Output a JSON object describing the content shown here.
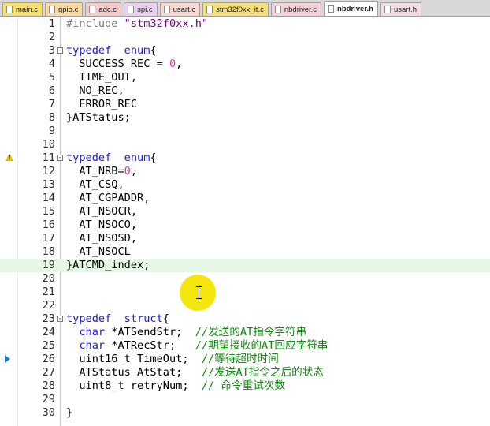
{
  "tabs": [
    {
      "label": "main.c",
      "color": "#f7e16b",
      "active": false
    },
    {
      "label": "gpio.c",
      "color": "#f9d9a0",
      "active": false
    },
    {
      "label": "adc.c",
      "color": "#f6c9c9",
      "active": false
    },
    {
      "label": "spi.c",
      "color": "#e9d0f0",
      "active": false
    },
    {
      "label": "usart.c",
      "color": "#f8d8d0",
      "active": false
    },
    {
      "label": "stm32f0xx_it.c",
      "color": "#f7e07a",
      "active": false
    },
    {
      "label": "nbdriver.c",
      "color": "#f6cfd9",
      "active": false
    },
    {
      "label": "nbdriver.h",
      "color": "#ffffff",
      "active": true
    },
    {
      "label": "usart.h",
      "color": "#f3dce6",
      "active": false
    }
  ],
  "editor": {
    "highlighted_line": 19,
    "lines": [
      {
        "n": "1",
        "segs": [
          [
            "pp",
            "#include "
          ],
          [
            "str",
            "\"stm32f0xx.h\""
          ]
        ]
      },
      {
        "n": "2",
        "segs": []
      },
      {
        "n": "3",
        "fold": "-",
        "segs": [
          [
            "kw",
            "typedef"
          ],
          [
            "",
            "  "
          ],
          [
            "kw",
            "enum"
          ],
          [
            "",
            "{"
          ]
        ]
      },
      {
        "n": "4",
        "segs": [
          [
            "",
            "  SUCCESS_REC = "
          ],
          [
            "num",
            "0"
          ],
          [
            "",
            ","
          ]
        ]
      },
      {
        "n": "5",
        "segs": [
          [
            "",
            "  TIME_OUT,"
          ]
        ]
      },
      {
        "n": "6",
        "segs": [
          [
            "",
            "  NO_REC,"
          ]
        ]
      },
      {
        "n": "7",
        "segs": [
          [
            "",
            "  ERROR_REC"
          ]
        ]
      },
      {
        "n": "8",
        "segs": [
          [
            "",
            "}ATStatus;"
          ]
        ]
      },
      {
        "n": "9",
        "segs": []
      },
      {
        "n": "10",
        "segs": []
      },
      {
        "n": "11",
        "fold": "-",
        "marker": "warning",
        "segs": [
          [
            "kw",
            "typedef"
          ],
          [
            "",
            "  "
          ],
          [
            "kw",
            "enum"
          ],
          [
            "",
            "{"
          ]
        ]
      },
      {
        "n": "12",
        "segs": [
          [
            "",
            "  AT_NRB="
          ],
          [
            "num",
            "0"
          ],
          [
            "",
            ","
          ]
        ]
      },
      {
        "n": "13",
        "segs": [
          [
            "",
            "  AT_CSQ,"
          ]
        ]
      },
      {
        "n": "14",
        "segs": [
          [
            "",
            "  AT_CGPADDR,"
          ]
        ]
      },
      {
        "n": "15",
        "segs": [
          [
            "",
            "  AT_NSOCR,"
          ]
        ]
      },
      {
        "n": "16",
        "segs": [
          [
            "",
            "  AT_NSOCO,"
          ]
        ]
      },
      {
        "n": "17",
        "segs": [
          [
            "",
            "  AT_NSOSD,"
          ]
        ]
      },
      {
        "n": "18",
        "segs": [
          [
            "",
            "  AT_NSOCL"
          ]
        ]
      },
      {
        "n": "19",
        "segs": [
          [
            "",
            "}ATCMD_index;"
          ]
        ]
      },
      {
        "n": "20",
        "segs": []
      },
      {
        "n": "21",
        "segs": []
      },
      {
        "n": "22",
        "segs": []
      },
      {
        "n": "23",
        "fold": "-",
        "segs": [
          [
            "kw",
            "typedef"
          ],
          [
            "",
            "  "
          ],
          [
            "kw",
            "struct"
          ],
          [
            "",
            "{"
          ]
        ]
      },
      {
        "n": "24",
        "segs": [
          [
            "",
            "  "
          ],
          [
            "kw",
            "char"
          ],
          [
            "",
            " *ATSendStr;  "
          ],
          [
            "cmt",
            "//发送的AT指令字符串"
          ]
        ]
      },
      {
        "n": "25",
        "segs": [
          [
            "",
            "  "
          ],
          [
            "kw",
            "char"
          ],
          [
            "",
            " *ATRecStr;   "
          ],
          [
            "cmt",
            "//期望接收的AT回应字符串"
          ]
        ]
      },
      {
        "n": "26",
        "marker": "exec",
        "segs": [
          [
            "",
            "  uint16_t TimeOut;  "
          ],
          [
            "cmt",
            "//等待超时时间"
          ]
        ]
      },
      {
        "n": "27",
        "segs": [
          [
            "",
            "  ATStatus AtStat;   "
          ],
          [
            "cmt",
            "//发送AT指令之后的状态"
          ]
        ]
      },
      {
        "n": "28",
        "segs": [
          [
            "",
            "  uint8_t retryNum;  "
          ],
          [
            "cmt",
            "// 命令重试次数"
          ]
        ]
      },
      {
        "n": "29",
        "segs": []
      },
      {
        "n": "30",
        "segs": [
          [
            "",
            "}"
          ]
        ]
      }
    ]
  }
}
